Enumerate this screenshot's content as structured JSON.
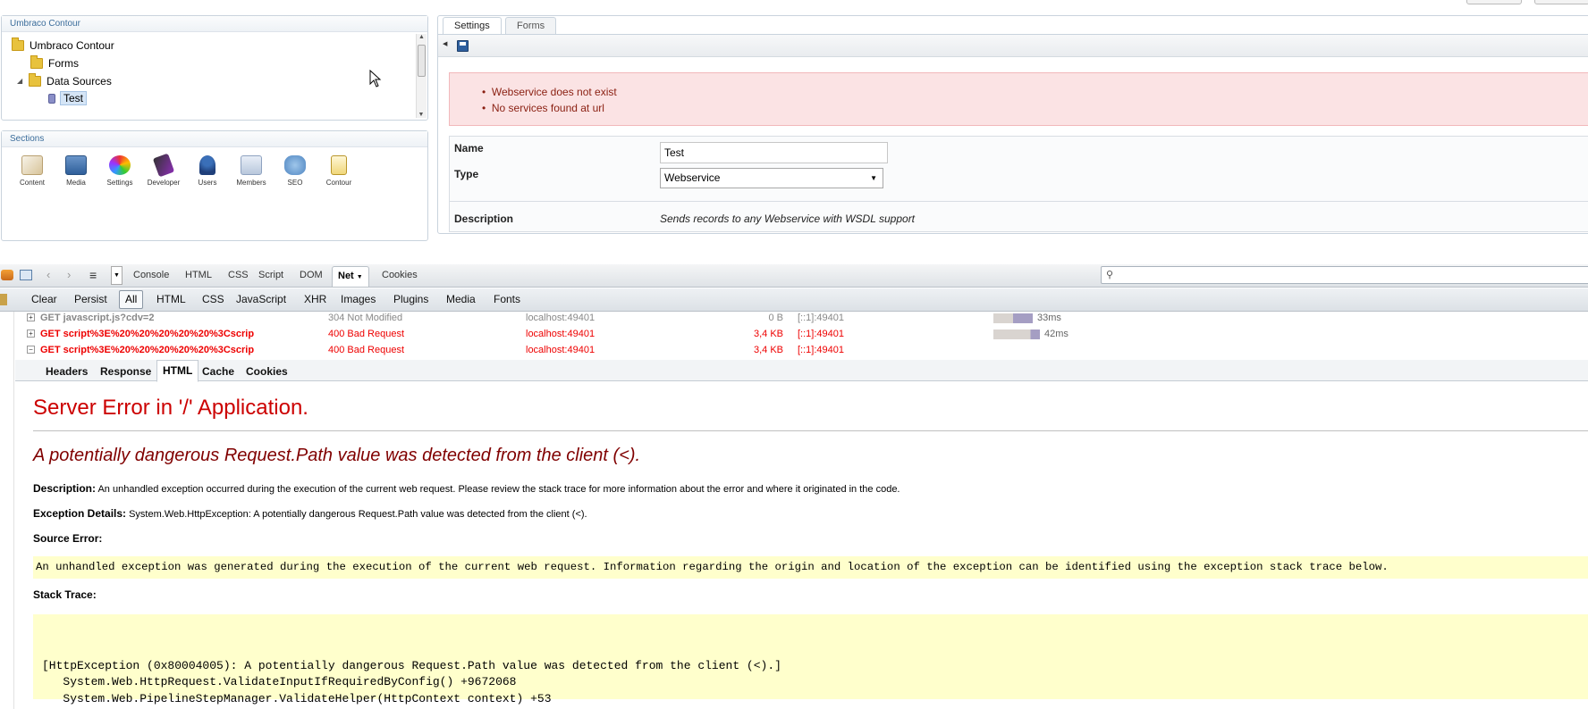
{
  "tree_panel": {
    "title": "Umbraco Contour",
    "items": [
      {
        "label": "Umbraco Contour"
      },
      {
        "label": "Forms"
      },
      {
        "label": "Data Sources"
      },
      {
        "label": "Test"
      }
    ]
  },
  "sections_panel": {
    "title": "Sections",
    "items": [
      "Content",
      "Media",
      "Settings",
      "Developer",
      "Users",
      "Members",
      "SEO",
      "Contour"
    ]
  },
  "editor": {
    "tabs": [
      "Settings",
      "Forms"
    ],
    "errors": [
      "Webservice does not exist",
      "No services found at url"
    ],
    "name_label": "Name",
    "name_value": "Test",
    "type_label": "Type",
    "type_value": "Webservice",
    "description_label": "Description",
    "description_value": "Sends records to any Webservice with WSDL support"
  },
  "firebug": {
    "tabs": [
      "Console",
      "HTML",
      "CSS",
      "Script",
      "DOM",
      "Net",
      "Cookies"
    ],
    "active_tab": "Net",
    "net_filters": [
      "Clear",
      "Persist",
      "All",
      "HTML",
      "CSS",
      "JavaScript",
      "XHR",
      "Images",
      "Plugins",
      "Media",
      "Fonts"
    ],
    "requests": [
      {
        "url": "GET javascript.js?cdv=2",
        "status": "304 Not Modified",
        "domain": "localhost:49401",
        "size": "0 B",
        "ip": "[::1]:49401",
        "time": "33ms",
        "expand": "+"
      },
      {
        "url": "GET script%3E%20%20%20%20%20%3Cscrip",
        "status": "400 Bad Request",
        "domain": "localhost:49401",
        "size": "3,4 KB",
        "ip": "[::1]:49401",
        "time": "42ms",
        "expand": "+"
      },
      {
        "url": "GET script%3E%20%20%20%20%20%3Cscrip",
        "status": "400 Bad Request",
        "domain": "localhost:49401",
        "size": "3,4 KB",
        "ip": "[::1]:49401",
        "time": "",
        "expand": "−"
      }
    ],
    "detail_tabs": [
      "Headers",
      "Response",
      "HTML",
      "Cache",
      "Cookies"
    ]
  },
  "error_page": {
    "title": "Server Error in '/' Application.",
    "subtitle": "A potentially dangerous Request.Path value was detected from the client (<).",
    "description_label": "Description:",
    "description_text": "An unhandled exception occurred during the execution of the current web request. Please review the stack trace for more information about the error and where it originated in the code.",
    "exception_label": "Exception Details:",
    "exception_text": "System.Web.HttpException: A potentially dangerous Request.Path value was detected from the client (<).",
    "source_label": "Source Error:",
    "source_text": "An unhandled exception was generated during the execution of the current web request. Information regarding the origin and location of the exception can be identified using the exception stack trace below.",
    "stack_label": "Stack Trace:",
    "stack_lines": [
      "[HttpException (0x80004005): A potentially dangerous Request.Path value was detected from the client (<).]",
      "   System.Web.HttpRequest.ValidateInputIfRequiredByConfig() +9672068",
      "   System.Web.PipelineStepManager.ValidateHelper(HttpContext context) +53"
    ]
  }
}
